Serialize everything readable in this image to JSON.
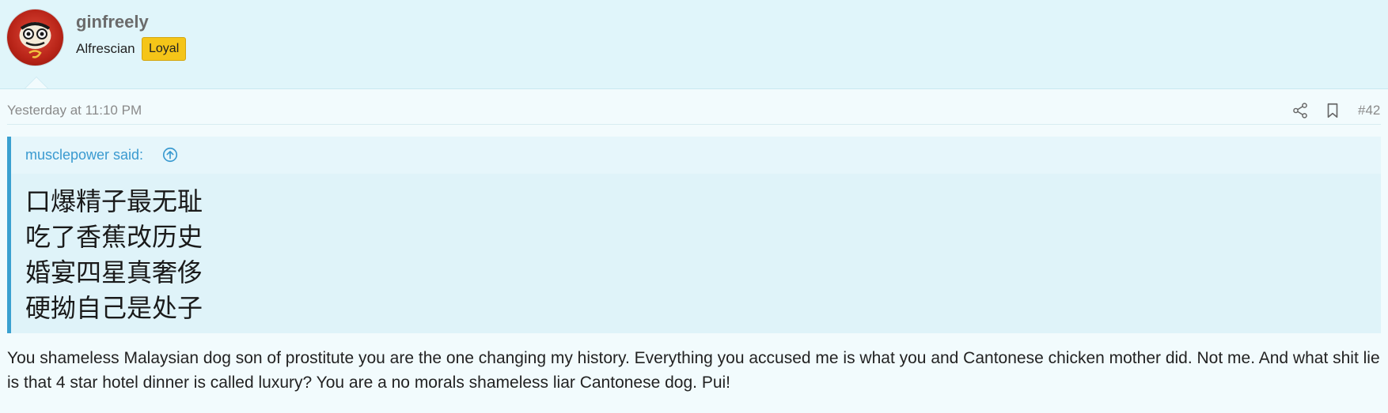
{
  "user": {
    "name": "ginfreely",
    "title": "Alfrescian",
    "badge": "Loyal",
    "avatar_icon": "daruma-doll-icon"
  },
  "post": {
    "timestamp": "Yesterday at 11:10 PM",
    "number": "#42",
    "actions": {
      "share_icon": "share-icon",
      "bookmark_icon": "bookmark-icon"
    },
    "quote": {
      "author_label": "musclepower said:",
      "lines": [
        "口爆精子最无耻",
        "吃了香蕉改历史",
        "婚宴四星真奢侈",
        "硬拗自己是处子"
      ]
    },
    "body": "You shameless Malaysian dog son of prostitute you are the one changing my history. Everything you accused me is what you and Cantonese chicken mother did. Not me. And what shit lie is that 4 star hotel dinner is called luxury? You are a no morals shameless liar Cantonese dog. Pui!"
  },
  "colors": {
    "accent": "#3aa0d0",
    "badge": "#f5c518",
    "header_bg": "#e0f5fa"
  }
}
